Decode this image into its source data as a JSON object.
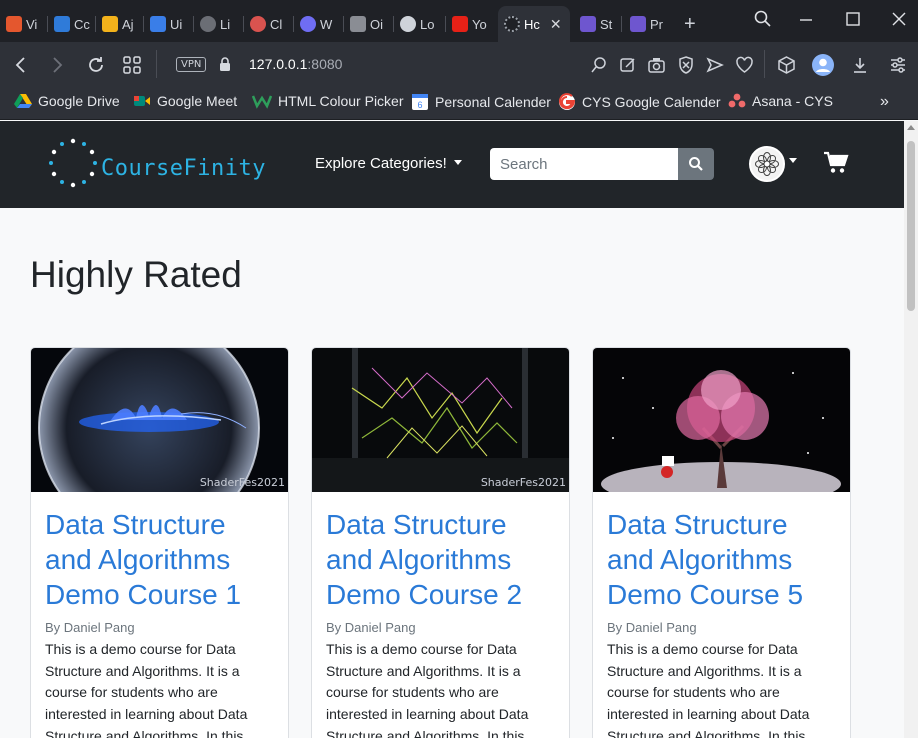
{
  "browser": {
    "tabs": [
      {
        "label": "Vi",
        "color": "#e4572e"
      },
      {
        "label": "Cc",
        "color": "#2f7bd9"
      },
      {
        "label": "Aj",
        "color": "#f3b21b"
      },
      {
        "label": "Ui",
        "color": "#3a7ee8"
      },
      {
        "label": "Li",
        "color": "#6b6e75"
      },
      {
        "label": "Cl",
        "color": "#d9534f"
      },
      {
        "label": "W",
        "color": "#6f6df3"
      },
      {
        "label": "Oi",
        "color": "#8a8d94"
      },
      {
        "label": "Lo",
        "color": "#cfd3da"
      },
      {
        "label": "Yo",
        "color": "#e62117"
      },
      {
        "label": "Hc",
        "color": "#9aa0a8"
      },
      {
        "label": "St",
        "color": "#6e56cf"
      },
      {
        "label": "Pr",
        "color": "#6e56cf"
      }
    ],
    "close_glyph": "✕",
    "new_tab_glyph": "+",
    "vpn_label": "VPN",
    "url_host": "127.0.0.1",
    "url_port": ":8080",
    "bookmarks": [
      {
        "label": "Google Drive",
        "color": "#f4b400"
      },
      {
        "label": "Google Meet",
        "color": "#00897b"
      },
      {
        "label": "HTML Colour Picker",
        "color": "#2e9e5b"
      },
      {
        "label": "Personal Calender",
        "color": "#4285f4"
      },
      {
        "label": "CYS Google Calender",
        "color": "#ea4335"
      },
      {
        "label": "Asana - CYS",
        "color": "#f06a6a"
      }
    ],
    "bookmarks_overflow": "»"
  },
  "navbar": {
    "brand": "CourseFinity",
    "explore_label": "Explore Categories!",
    "search_placeholder": "Search"
  },
  "section_title": "Highly Rated",
  "courses": [
    {
      "title": "Data Structure and Algorithms Demo Course 1",
      "author": "By Daniel Pang",
      "description": "This is a demo course for Data Structure and Algorithms. It is a course for students who are interested in learning about Data Structure and Algorithms. In this",
      "watermark": "ShaderFes2021"
    },
    {
      "title": "Data Structure and Algorithms Demo Course 2",
      "author": "By Daniel Pang",
      "description": "This is a demo course for Data Structure and Algorithms. It is a course for students who are interested in learning about Data Structure and Algorithms. In this",
      "watermark": "ShaderFes2021"
    },
    {
      "title": "Data Structure and Algorithms Demo Course 5",
      "author": "By Daniel Pang",
      "description": "This is a demo course for Data Structure and Algorithms. It is a course for students who are interested in learning about Data Structure and Algorithms. In this",
      "watermark": ""
    }
  ]
}
